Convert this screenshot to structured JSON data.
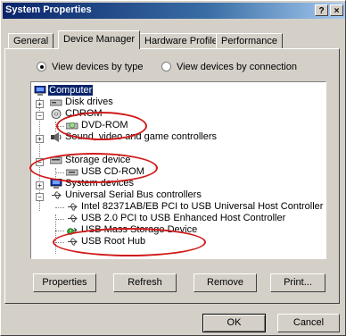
{
  "window": {
    "title": "System Properties",
    "help_glyph": "?",
    "close_glyph": "×"
  },
  "tabs": [
    {
      "label": "General"
    },
    {
      "label": "Device Manager",
      "active": true
    },
    {
      "label": "Hardware Profiles"
    },
    {
      "label": "Performance"
    }
  ],
  "view_options": {
    "by_type_label": "View devices by type",
    "by_connection_label": "View devices by connection",
    "selected": "by_type"
  },
  "tree": {
    "root": "Computer",
    "items": [
      {
        "label": "Disk drives"
      },
      {
        "label": "CDROM"
      },
      {
        "label": "DVD-ROM"
      },
      {
        "label": "Sound, video and game controllers"
      },
      {
        "label": "Storage device"
      },
      {
        "label": "USB CD-ROM"
      },
      {
        "label": "System devices"
      },
      {
        "label": "Universal Serial Bus controllers"
      },
      {
        "label": "Intel 82371AB/EB PCI to USB Universal Host Controller"
      },
      {
        "label": "USB 2.0 PCI to USB Enhanced Host Controller"
      },
      {
        "label": "USB Mass Storage Device"
      },
      {
        "label": "USB Root Hub"
      }
    ]
  },
  "buttons": {
    "properties": "Properties",
    "refresh": "Refresh",
    "remove": "Remove",
    "print": "Print...",
    "ok": "OK",
    "cancel": "Cancel"
  },
  "colors": {
    "highlight_ellipse": "#d11a1a",
    "selection": "#0a246a"
  }
}
